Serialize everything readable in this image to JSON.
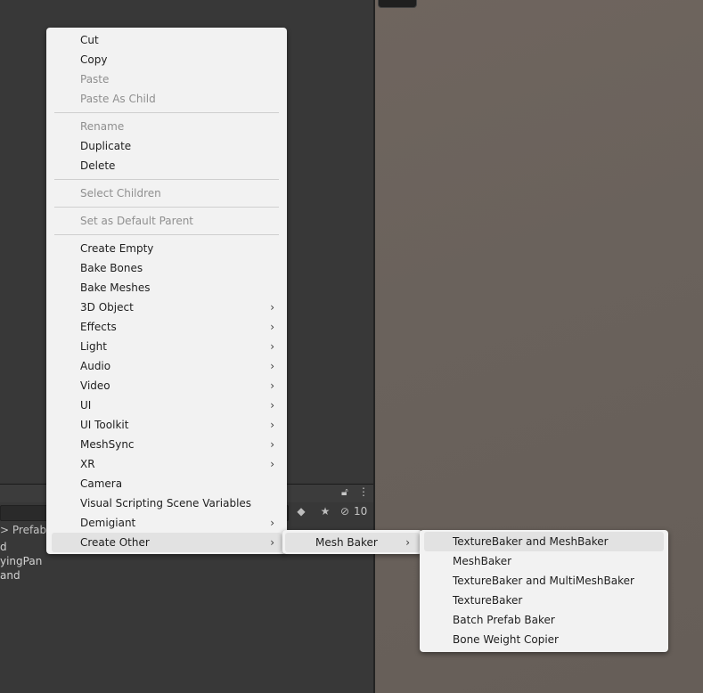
{
  "main_menu": {
    "items": [
      {
        "label": "Cut",
        "enabled": true
      },
      {
        "label": "Copy",
        "enabled": true
      },
      {
        "label": "Paste",
        "enabled": false
      },
      {
        "label": "Paste As Child",
        "enabled": false
      },
      {
        "label": "Rename",
        "enabled": false
      },
      {
        "label": "Duplicate",
        "enabled": true
      },
      {
        "label": "Delete",
        "enabled": true
      },
      {
        "label": "Select Children",
        "enabled": false
      },
      {
        "label": "Set as Default Parent",
        "enabled": false
      },
      {
        "label": "Create Empty",
        "enabled": true
      },
      {
        "label": "Bake Bones",
        "enabled": true
      },
      {
        "label": "Bake Meshes",
        "enabled": true
      },
      {
        "label": "3D Object",
        "enabled": true,
        "submenu": true
      },
      {
        "label": "Effects",
        "enabled": true,
        "submenu": true
      },
      {
        "label": "Light",
        "enabled": true,
        "submenu": true
      },
      {
        "label": "Audio",
        "enabled": true,
        "submenu": true
      },
      {
        "label": "Video",
        "enabled": true,
        "submenu": true
      },
      {
        "label": "UI",
        "enabled": true,
        "submenu": true
      },
      {
        "label": "UI Toolkit",
        "enabled": true,
        "submenu": true
      },
      {
        "label": "MeshSync",
        "enabled": true,
        "submenu": true
      },
      {
        "label": "XR",
        "enabled": true,
        "submenu": true
      },
      {
        "label": "Camera",
        "enabled": true
      },
      {
        "label": "Visual Scripting Scene Variables",
        "enabled": true
      },
      {
        "label": "Demigiant",
        "enabled": true,
        "submenu": true
      },
      {
        "label": "Create Other",
        "enabled": true,
        "submenu": true,
        "highlighted": true
      }
    ],
    "submenu_arrow": "›"
  },
  "create_other_menu": {
    "items": [
      {
        "label": "Mesh Baker",
        "submenu": true,
        "highlighted": true
      }
    ]
  },
  "mesh_baker_menu": {
    "items": [
      {
        "label": "TextureBaker and MeshBaker",
        "highlighted": true
      },
      {
        "label": "MeshBaker"
      },
      {
        "label": "TextureBaker and MultiMeshBaker"
      },
      {
        "label": "TextureBaker"
      },
      {
        "label": "Batch Prefab Baker"
      },
      {
        "label": "Bone Weight Copier"
      }
    ]
  },
  "project_panel": {
    "hidden_count": "10",
    "breadcrumb": "> Prefab",
    "tree_items": [
      "d",
      "yingPan",
      "and"
    ],
    "icons": [
      "tag-icon",
      "star-icon",
      "eye-slash-icon",
      "lock-icon",
      "kebab-icon"
    ]
  },
  "colors": {
    "menu_bg": "#f2f2f2",
    "menu_highlight": "#e2e2e2",
    "disabled_text": "#8f8f8f",
    "editor_bg": "#383838",
    "scene_bg": "#6a625c"
  }
}
